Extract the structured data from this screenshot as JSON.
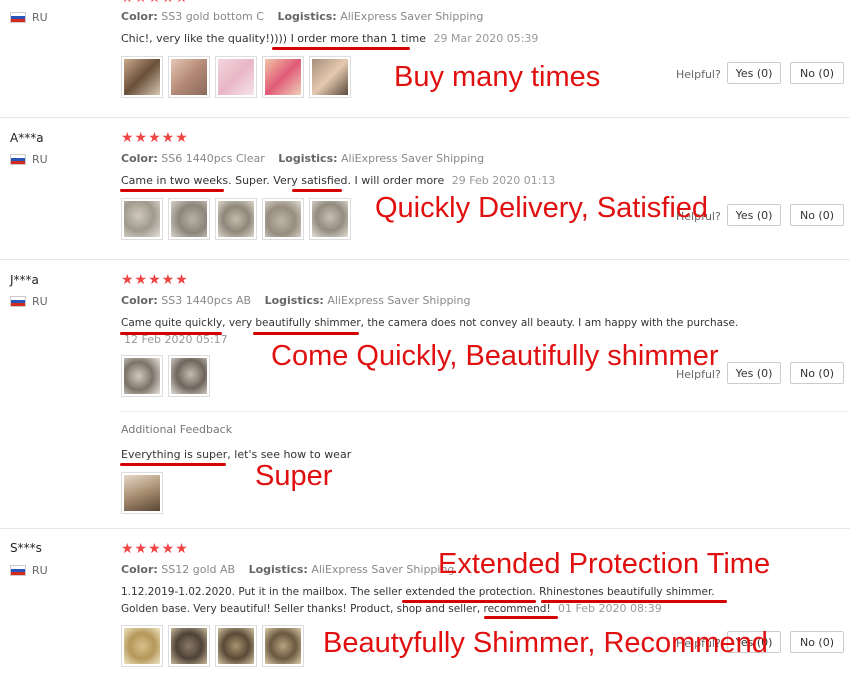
{
  "reviews": [
    {
      "user": "",
      "country": "RU",
      "stars": "★★★★★",
      "color_label": "Color:",
      "color_value": "SS3 gold bottom C",
      "logistics_label": "Logistics:",
      "logistics_value": "AliExpress Saver Shipping",
      "text": "Chic!, very like the quality!)))) I order more than 1 time",
      "date": "29 Mar 2020 05:39",
      "helpful": "Helpful?",
      "yes": "Yes (0)",
      "no": "No (0)",
      "annotation": "Buy many times"
    },
    {
      "user": "A***a",
      "country": "RU",
      "stars": "★★★★★",
      "color_label": "Color:",
      "color_value": "SS6 1440pcs Clear",
      "logistics_label": "Logistics:",
      "logistics_value": "AliExpress Saver Shipping",
      "text": "Came in two weeks. Super. Very satisfied. I will order more",
      "date": "29 Feb 2020 01:13",
      "helpful": "Helpful?",
      "yes": "Yes (0)",
      "no": "No (0)",
      "annotation": "Quickly Delivery, Satisfied"
    },
    {
      "user": "J***a",
      "country": "RU",
      "stars": "★★★★★",
      "color_label": "Color:",
      "color_value": "SS3 1440pcs AB",
      "logistics_label": "Logistics:",
      "logistics_value": "AliExpress Saver Shipping",
      "text": "Came quite quickly, very beautifully shimmer, the camera does not convey all beauty. I am happy with the purchase.",
      "date": "12 Feb 2020 05:17",
      "helpful": "Helpful?",
      "yes": "Yes (0)",
      "no": "No (0)",
      "annotation": "Come Quickly, Beautifully shimmer",
      "additional_label": "Additional Feedback",
      "additional_text": "Everything is super, let's see how to wear",
      "additional_annotation": "Super"
    },
    {
      "user": "S***s",
      "country": "RU",
      "stars": "★★★★★",
      "color_label": "Color:",
      "color_value": "SS12 gold AB",
      "logistics_label": "Logistics:",
      "logistics_value": "AliExpress Saver Shipping",
      "text1": "1.12.2019-1.02.2020. Put it in the mailbox. The seller extended the protection. Rhinestones beautifully shimmer.",
      "text2": "Golden base. Very beautiful! Seller thanks! Product, shop and seller, recommend!",
      "date": "01 Feb 2020 08:39",
      "helpful": "Helpful?",
      "yes": "Yes (0)",
      "no": "No (0)",
      "annotation_top": "Extended Protection Time",
      "annotation_bottom": "Beautyfully Shimmer, Recommend"
    }
  ],
  "colors": {
    "star": "#f04545",
    "annotation": "#e01010",
    "underline": "#d40000"
  }
}
